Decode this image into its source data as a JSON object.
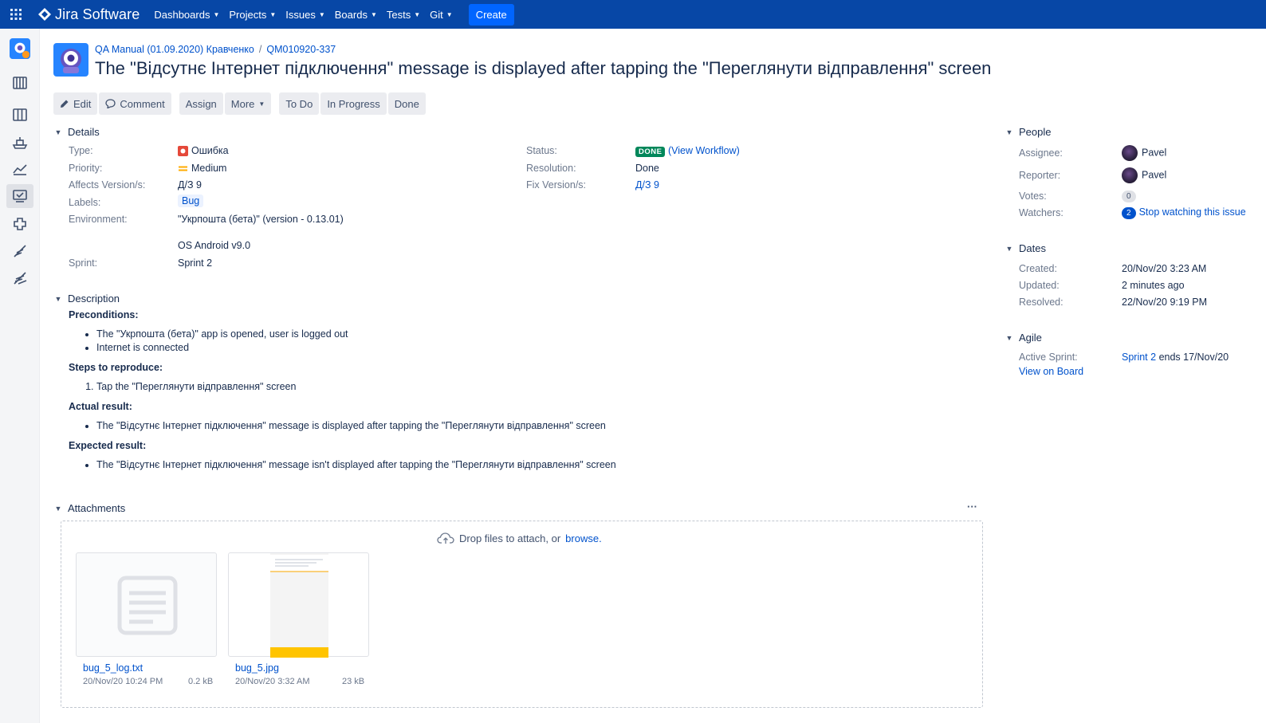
{
  "nav": {
    "brand": "Jira Software",
    "items": [
      {
        "label": "Dashboards"
      },
      {
        "label": "Projects"
      },
      {
        "label": "Issues"
      },
      {
        "label": "Boards"
      },
      {
        "label": "Tests"
      },
      {
        "label": "Git"
      }
    ],
    "create": "Create"
  },
  "sidebar": {
    "icons": [
      "project-avatar-icon",
      "backlog-icon",
      "board-icon",
      "releases-icon",
      "reports-icon",
      "issues-icon",
      "components-icon",
      "feather-icon",
      "speed-icon"
    ]
  },
  "breadcrumbs": {
    "project": "QA Manual (01.09.2020) Кравченко",
    "separator": "/",
    "issue_key": "QM010920-337"
  },
  "title": "The \"Відсутнє Інтернет підключення\" message is displayed after tapping the \"Переглянути відправлення\" screen",
  "toolbar": {
    "edit": "Edit",
    "comment": "Comment",
    "assign": "Assign",
    "more": "More",
    "todo": "To Do",
    "in_progress": "In Progress",
    "done": "Done"
  },
  "details": {
    "heading": "Details",
    "type_label": "Type:",
    "type_value": "Ошибка",
    "priority_label": "Priority:",
    "priority_value": "Medium",
    "affects_label": "Affects Version/s:",
    "affects_value": "Д/З 9",
    "labels_label": "Labels:",
    "labels_value": "Bug",
    "environment_label": "Environment:",
    "environment_line1": "\"Укрпошта (бета)\" (version - 0.13.01)",
    "environment_line2": "OS Android v9.0",
    "sprint_label": "Sprint:",
    "sprint_value": "Sprint 2",
    "status_label": "Status:",
    "status_value": "DONE",
    "view_workflow": "(View Workflow)",
    "resolution_label": "Resolution:",
    "resolution_value": "Done",
    "fix_label": "Fix Version/s:",
    "fix_value": "Д/З 9"
  },
  "description": {
    "heading": "Description",
    "preconditions_title": "Preconditions:",
    "preconditions": [
      "The \"Укрпошта (бета)\" app is opened, user is logged out",
      "Internet is connected"
    ],
    "steps_title": "Steps to reproduce:",
    "steps": [
      "Tap the \"Переглянути відправлення\" screen"
    ],
    "actual_title": "Actual result:",
    "actual": [
      "The \"Відсутнє Інтернет підключення\" message is displayed after tapping the \"Переглянути відправлення\" screen"
    ],
    "expected_title": "Expected result:",
    "expected": [
      "The \"Відсутнє Інтернет підключення\" message isn't displayed after tapping the \"Переглянути відправлення\" screen"
    ]
  },
  "attachments": {
    "heading": "Attachments",
    "more": "···",
    "drop_text": "Drop files to attach, or",
    "browse": "browse.",
    "files": [
      {
        "name": "bug_5_log.txt",
        "date": "20/Nov/20 10:24 PM",
        "size": "0.2 kB"
      },
      {
        "name": "bug_5.jpg",
        "date": "20/Nov/20 3:32 AM",
        "size": "23 kB"
      }
    ]
  },
  "people": {
    "heading": "People",
    "assignee_label": "Assignee:",
    "assignee": "Pavel",
    "reporter_label": "Reporter:",
    "reporter": "Pavel",
    "votes_label": "Votes:",
    "votes": "0",
    "watchers_label": "Watchers:",
    "watchers": "2",
    "stop_watching": "Stop watching this issue"
  },
  "dates": {
    "heading": "Dates",
    "created_label": "Created:",
    "created": "20/Nov/20 3:23 AM",
    "updated_label": "Updated:",
    "updated": "2 minutes ago",
    "resolved_label": "Resolved:",
    "resolved": "22/Nov/20 9:19 PM"
  },
  "agile": {
    "heading": "Agile",
    "active_sprint_label": "Active Sprint:",
    "sprint_link": "Sprint 2",
    "sprint_ends": "ends 17/Nov/20",
    "view_on_board": "View on Board"
  },
  "colors": {
    "nav_bg": "#0747a6",
    "create_bg": "#0065ff",
    "link": "#0052cc",
    "done_green": "#00875a",
    "bug_red": "#e5493a",
    "medium_orange": "#ffab00"
  }
}
